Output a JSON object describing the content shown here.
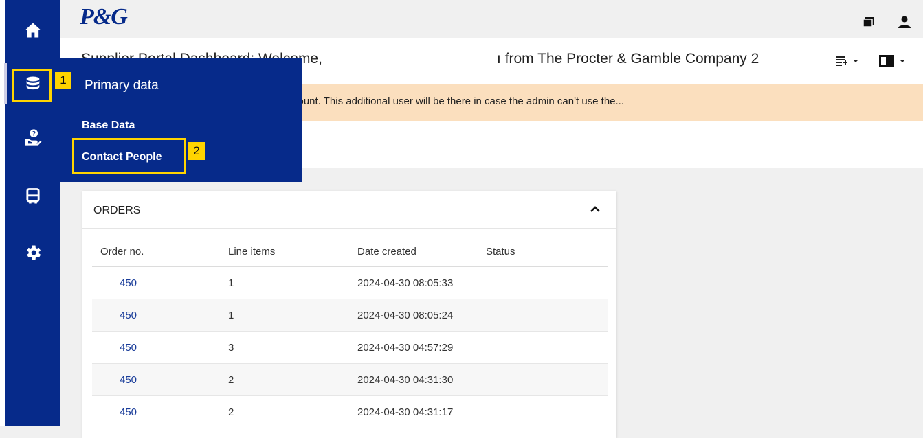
{
  "rail": {
    "items": [
      {
        "icon": "home-icon"
      },
      {
        "icon": "database-icon"
      },
      {
        "icon": "help-hand-icon"
      },
      {
        "icon": "truck-icon"
      },
      {
        "icon": "gear-icon"
      }
    ]
  },
  "header": {
    "logo": "P&G",
    "icons": [
      "messages-icon",
      "user-icon"
    ]
  },
  "welcome": {
    "left_text": "Supplier Portal Dashboard: Welcome,",
    "right_text": "ı from The Procter & Gamble Company 2"
  },
  "notice": {
    "text": "backup user for your company's JAGGAER account. This additional user will be there in case the admin can't use the..."
  },
  "flyout": {
    "title": "Primary data",
    "items": [
      "Base Data",
      "Contact People"
    ]
  },
  "annotations": {
    "tag1": "1",
    "tag2": "2"
  },
  "orders": {
    "title": "ORDERS",
    "columns": [
      "Order no.",
      "Line items",
      "Date created",
      "Status"
    ],
    "rows": [
      {
        "order_no": "450",
        "line_items": "1",
        "date_created": "2024-04-30 08:05:33",
        "status": ""
      },
      {
        "order_no": "450",
        "line_items": "1",
        "date_created": "2024-04-30 08:05:24",
        "status": ""
      },
      {
        "order_no": "450",
        "line_items": "3",
        "date_created": "2024-04-30 04:57:29",
        "status": ""
      },
      {
        "order_no": "450",
        "line_items": "2",
        "date_created": "2024-04-30 04:31:30",
        "status": ""
      },
      {
        "order_no": "450",
        "line_items": "2",
        "date_created": "2024-04-30 04:31:17",
        "status": ""
      }
    ]
  },
  "colors": {
    "brand_navy": "#062a8a",
    "highlight_yellow": "#ffd400",
    "notice_bg": "#fbdfbe"
  }
}
